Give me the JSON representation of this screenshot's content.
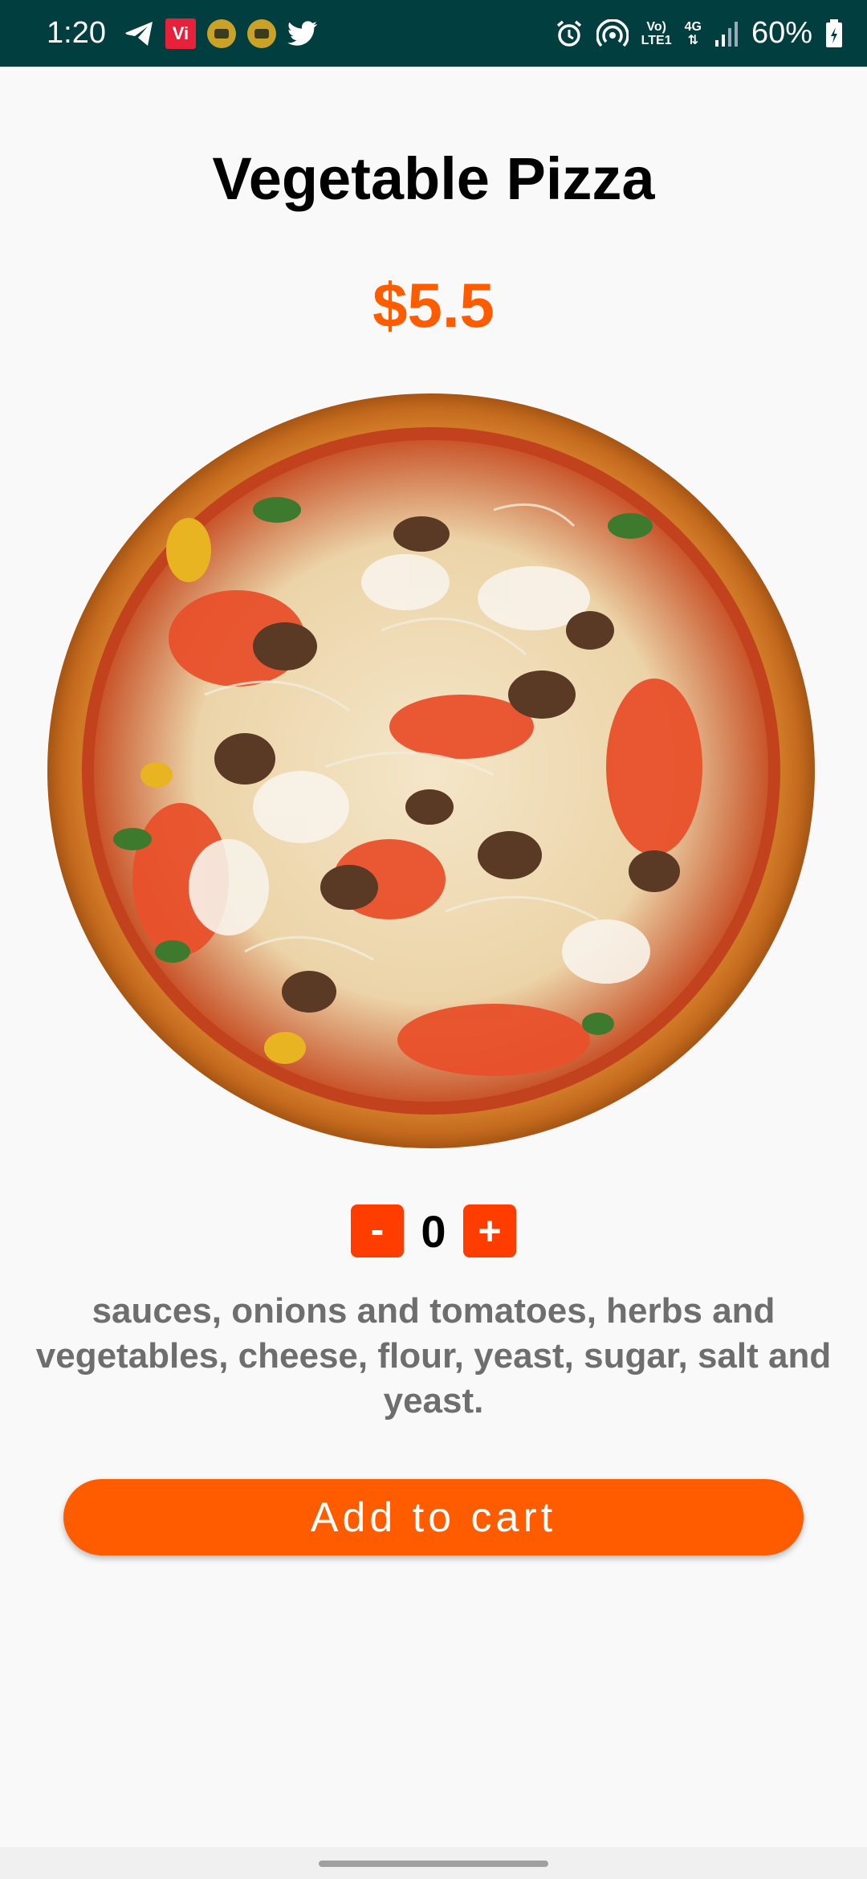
{
  "status_bar": {
    "time": "1:20",
    "badge": "Vi",
    "network_label_top": "Vo)",
    "network_label_bottom": "LTE1",
    "network_type": "4G",
    "battery": "60%",
    "icons": [
      "telegram-icon",
      "vi-app-icon",
      "notification-icon",
      "notification-icon",
      "twitter-icon",
      "alarm-icon",
      "hotspot-icon",
      "signal-icon",
      "battery-icon"
    ]
  },
  "product": {
    "name": "Vegetable Pizza",
    "price": "$5.5",
    "image": "pizza-image",
    "quantity": "0",
    "description": "sauces, onions and tomatoes, herbs and vegetables, cheese, flour, yeast, sugar, salt and yeast."
  },
  "controls": {
    "minus_label": "-",
    "plus_label": "+",
    "add_to_cart_label": "Add to cart"
  },
  "colors": {
    "status_bar": "#003e40",
    "accent": "#ff5c00",
    "qty_button": "#ff3d00",
    "description_text": "#6e6e6e",
    "background": "#f9f9fa"
  }
}
